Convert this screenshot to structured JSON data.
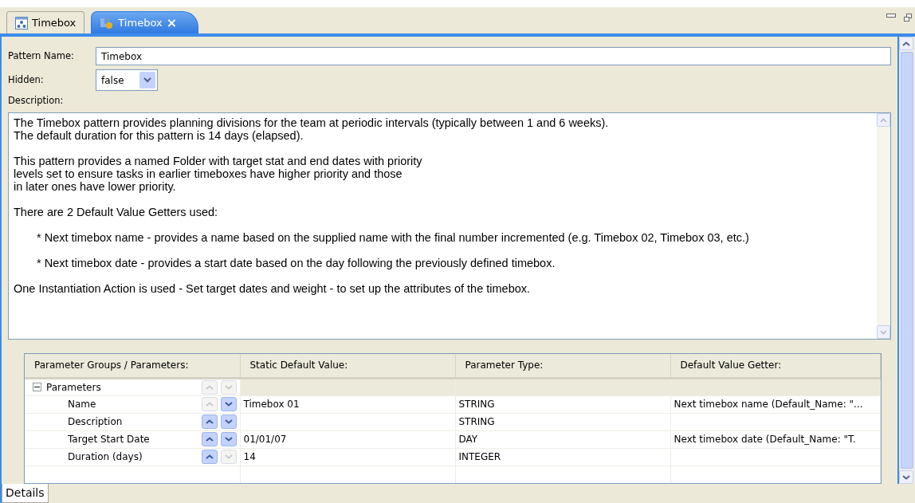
{
  "tabs": [
    {
      "label": "Timebox",
      "kind": "diagram",
      "selected": false,
      "closable": false
    },
    {
      "label": "Timebox",
      "kind": "pattern",
      "selected": true,
      "closable": true
    }
  ],
  "close_glyph": "×",
  "form": {
    "pattern_name_label": "Pattern Name:",
    "pattern_name": "Timebox",
    "hidden_label": "Hidden:",
    "hidden_value": "false",
    "description_label": "Description:"
  },
  "description": [
    {
      "indented": false,
      "lines": [
        "The Timebox pattern provides planning divisions for the team at periodic intervals (typically between 1 and 6 weeks).",
        "The default duration for this pattern is 14 days (elapsed)."
      ]
    },
    {
      "indented": false,
      "lines": [
        "This pattern provides a named Folder with target stat and end dates with priority",
        "levels set to ensure tasks in earlier timeboxes have higher priority and those",
        "in later ones have lower priority."
      ]
    },
    {
      "indented": false,
      "lines": [
        "There are 2 Default Value Getters used:"
      ]
    },
    {
      "indented": true,
      "lines": [
        "* Next timebox name - provides a name based on the supplied name with the final number incremented (e.g. Timebox 02, Timebox 03, etc.)"
      ]
    },
    {
      "indented": true,
      "lines": [
        "* Next timebox date - provides a start date based on the day following the previously defined timebox."
      ]
    },
    {
      "indented": false,
      "lines": [
        "One Instantiation Action is used - Set target dates and weight - to set up the attributes of the timebox."
      ]
    }
  ],
  "table": {
    "columns": [
      "Parameter Groups / Parameters:",
      "Static Default Value:",
      "Parameter Type:",
      "Default Value Getter:"
    ],
    "groups": [
      {
        "label": "Parameters",
        "expanded": true,
        "up_enabled": false,
        "down_enabled": false,
        "children": [
          {
            "label": "Name",
            "up_enabled": false,
            "down_enabled": true,
            "static_default": "Timebox 01",
            "type": "STRING",
            "getter": "Next timebox name (Default_Name: \"..."
          },
          {
            "label": "Description",
            "up_enabled": true,
            "down_enabled": true,
            "type": "STRING"
          },
          {
            "label": "Target Start Date",
            "up_enabled": true,
            "down_enabled": true,
            "static_default": "01/01/07",
            "type": "DAY",
            "getter": "Next timebox date (Default_Name: \"T."
          },
          {
            "label": "Duration (days)",
            "up_enabled": true,
            "down_enabled": false,
            "static_default": "14",
            "type": "INTEGER"
          }
        ]
      }
    ]
  },
  "bottom_tabs": [
    {
      "label": "Details",
      "selected": true
    }
  ]
}
